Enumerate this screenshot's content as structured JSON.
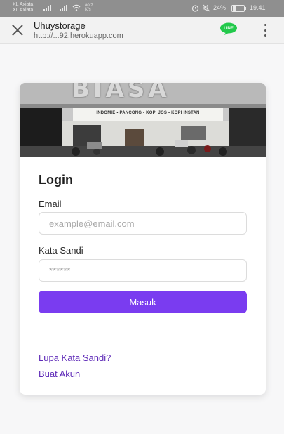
{
  "status_bar": {
    "carrier_1": "XL Axiata",
    "carrier_2": "XL Axiata",
    "net_speed": "80.7",
    "net_unit": "K/s",
    "battery": "24%",
    "time": "19.41"
  },
  "browser": {
    "title": "Uhuystorage",
    "url": "http://...92.herokuapp.com",
    "line_label": "LINE"
  },
  "hero": {
    "store_name": "BIASA",
    "sign_text": "INDOMIE • PANCONG • KOPI JOS • KOPI INSTAN"
  },
  "login": {
    "title": "Login",
    "email_label": "Email",
    "email_placeholder": "example@email.com",
    "password_label": "Kata Sandi",
    "password_placeholder": "******",
    "submit_label": "Masuk",
    "forgot_link": "Lupa Kata Sandi?",
    "register_link": "Buat Akun"
  },
  "colors": {
    "primary": "#7a3cf0",
    "link": "#5f2bb8",
    "line_green": "#22c94b"
  }
}
